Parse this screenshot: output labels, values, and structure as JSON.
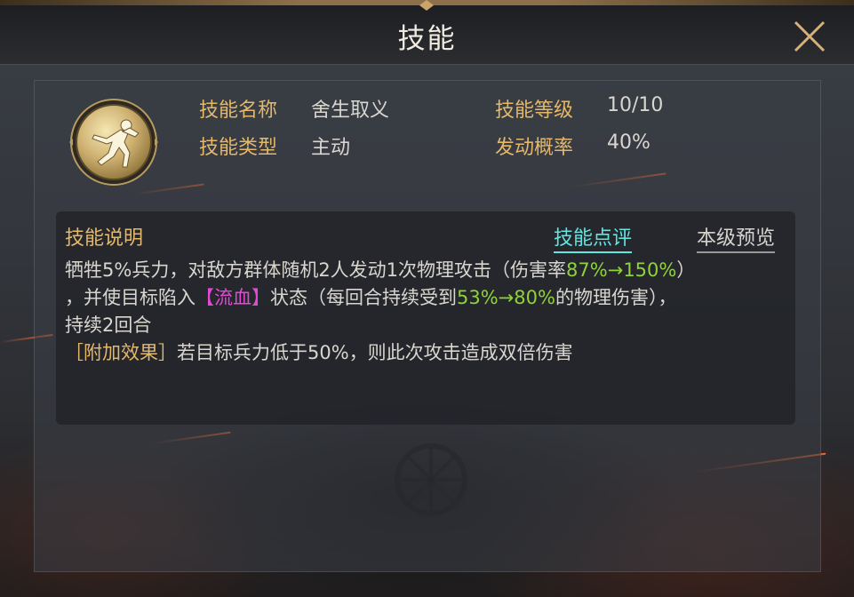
{
  "window": {
    "title": "技能"
  },
  "skill": {
    "name_label": "技能名称",
    "name_value": "舍生取义",
    "type_label": "技能类型",
    "type_value": "主动",
    "level_label": "技能等级",
    "level_value": "10/10",
    "rate_label": "发动概率",
    "rate_value": "40%"
  },
  "description": {
    "title": "技能说明",
    "tab_review": "技能点评",
    "tab_preview": "本级预览",
    "segments": {
      "s1": "牺牲5%兵力，对敌方群体随机2人发动1次物理攻击（伤害率",
      "s2": "87%→150%",
      "s3": "）",
      "s4": "，并使目标陷入",
      "s5": "【流血】",
      "s6": "状态（每回合持续受到",
      "s7": "53%→80%",
      "s8": "的物理伤害），",
      "s9": "持续2回合",
      "s10": "［附加效果］",
      "s11": "若目标兵力低于50%，则此次攻击造成双倍伤害"
    }
  },
  "icons": {
    "close": "close-icon",
    "emblem": "running-figure-icon"
  },
  "colors": {
    "label_gold": "#e5b869",
    "highlight_green": "#8fd23a",
    "highlight_pink": "#e24ad6",
    "tab_cyan": "#5ee6e0"
  }
}
